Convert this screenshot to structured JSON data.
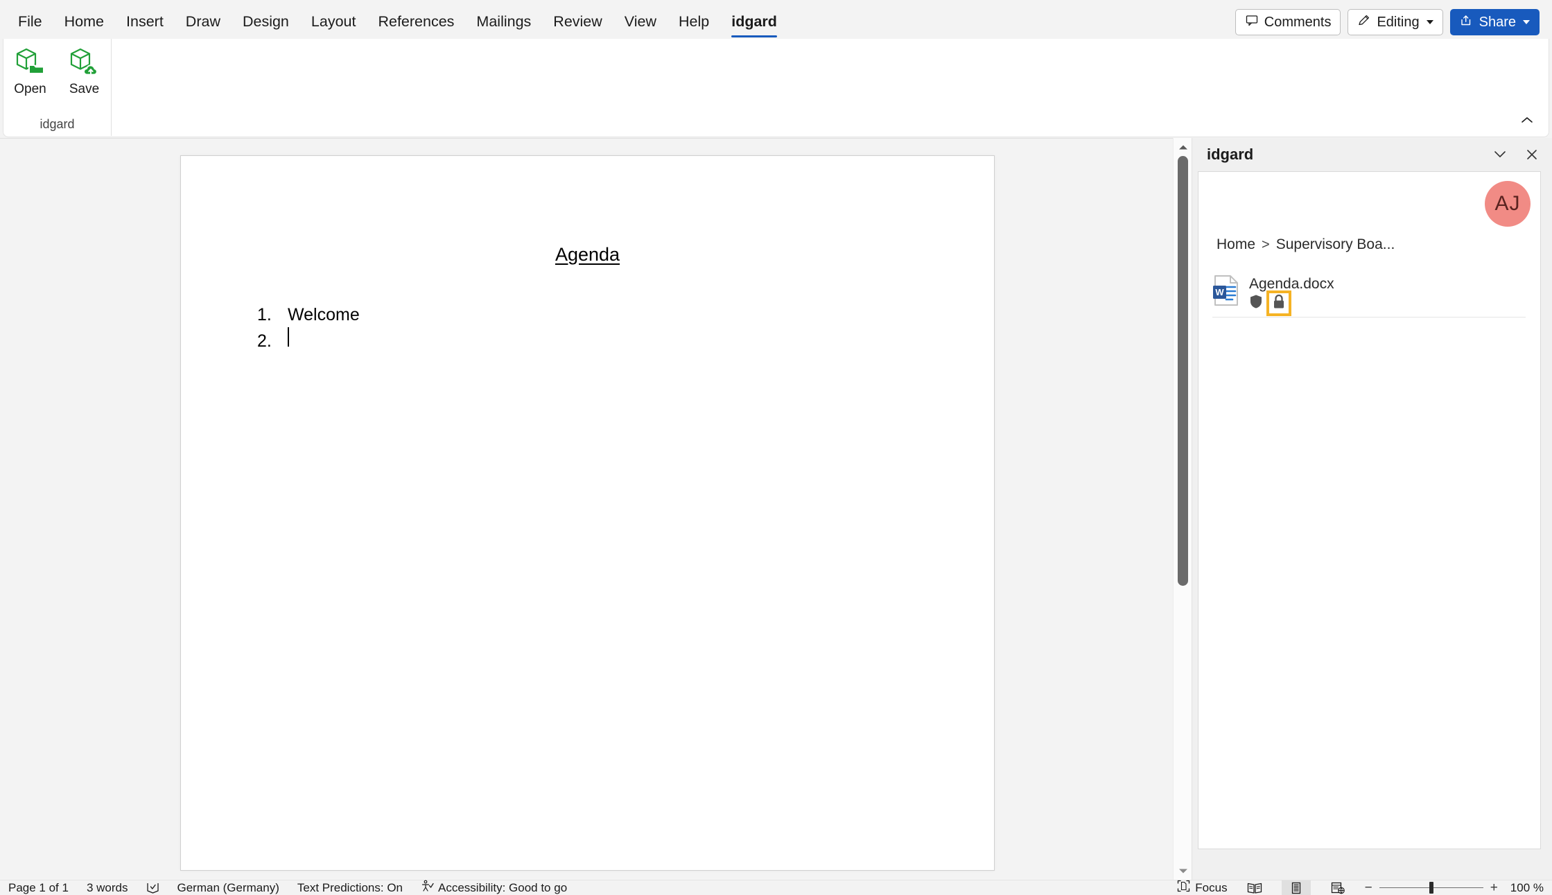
{
  "ribbon": {
    "tabs": [
      {
        "label": "File",
        "active": false
      },
      {
        "label": "Home",
        "active": false
      },
      {
        "label": "Insert",
        "active": false
      },
      {
        "label": "Draw",
        "active": false
      },
      {
        "label": "Design",
        "active": false
      },
      {
        "label": "Layout",
        "active": false
      },
      {
        "label": "References",
        "active": false
      },
      {
        "label": "Mailings",
        "active": false
      },
      {
        "label": "Review",
        "active": false
      },
      {
        "label": "View",
        "active": false
      },
      {
        "label": "Help",
        "active": false
      },
      {
        "label": "idgard",
        "active": true
      }
    ],
    "comments_label": "Comments",
    "editing_label": "Editing",
    "share_label": "Share",
    "group": {
      "title": "idgard",
      "open_label": "Open",
      "save_label": "Save"
    },
    "collapse_icon": "chevron-up-icon",
    "accent_color": "#185abd",
    "brand_green": "#21a038"
  },
  "document": {
    "title": "Agenda",
    "list": [
      {
        "number": "1.",
        "text": "Welcome"
      },
      {
        "number": "2.",
        "text": ""
      }
    ]
  },
  "pane": {
    "title": "idgard",
    "collapse_icon": "chevron-down-icon",
    "close_icon": "close-icon",
    "avatar_initials": "AJ",
    "avatar_color": "#f18b85",
    "breadcrumb": [
      {
        "label": "Home"
      },
      {
        "label": "Supervisory Boa..."
      }
    ],
    "breadcrumb_separator": ">",
    "file": {
      "name": "Agenda.docx",
      "icon": "word-document-icon",
      "badges": [
        {
          "icon": "shield-icon",
          "highlighted": false
        },
        {
          "icon": "lock-icon",
          "highlighted": true
        }
      ],
      "highlight_color": "#f5b325"
    }
  },
  "status": {
    "page": "Page 1 of 1",
    "words": "3 words",
    "proofing_icon": "proofing-icon",
    "language": "German (Germany)",
    "text_predictions": "Text Predictions: On",
    "accessibility": "Accessibility: Good to go",
    "accessibility_icon": "accessibility-icon",
    "focus_label": "Focus",
    "focus_icon": "focus-icon",
    "view_read_icon": "read-mode-icon",
    "view_print_icon": "print-layout-icon",
    "view_web_icon": "web-layout-icon",
    "zoom_out": "−",
    "zoom_in": "+",
    "zoom_level": "100 %"
  }
}
